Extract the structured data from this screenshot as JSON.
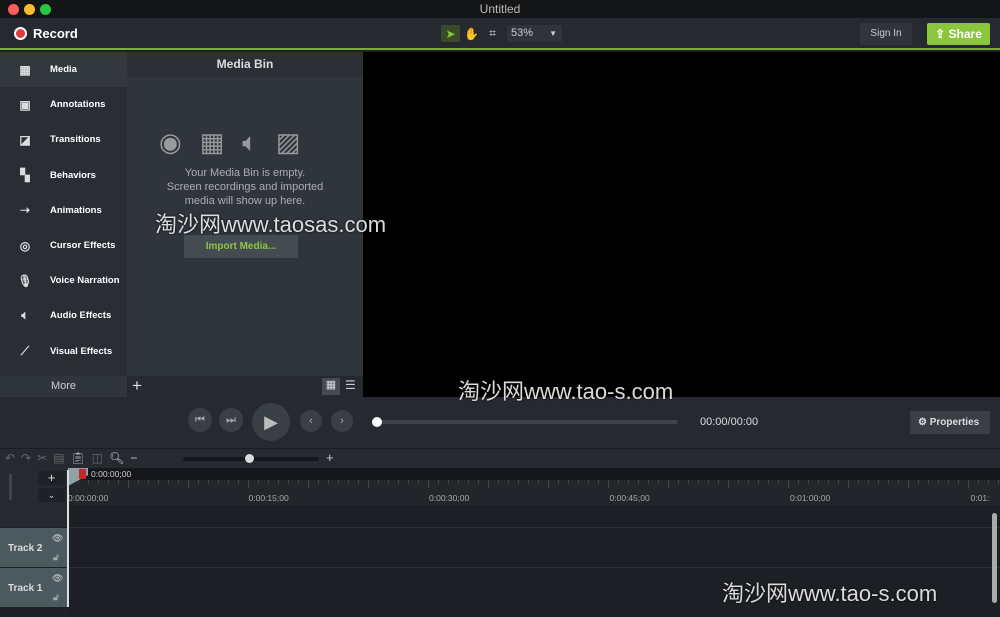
{
  "window": {
    "title": "Untitled"
  },
  "toolbar": {
    "record": "Record",
    "zoom": "53%",
    "sign_in": "Sign In",
    "share": "Share",
    "accent": "#8cc63f"
  },
  "sidebar": {
    "items": [
      {
        "label": "Media",
        "icon": "film-icon"
      },
      {
        "label": "Annotations",
        "icon": "annotation-icon"
      },
      {
        "label": "Transitions",
        "icon": "transition-icon"
      },
      {
        "label": "Behaviors",
        "icon": "behaviors-icon"
      },
      {
        "label": "Animations",
        "icon": "animation-icon"
      },
      {
        "label": "Cursor Effects",
        "icon": "cursor-icon"
      },
      {
        "label": "Voice Narration",
        "icon": "microphone-icon"
      },
      {
        "label": "Audio Effects",
        "icon": "speaker-icon"
      },
      {
        "label": "Visual Effects",
        "icon": "wand-icon"
      }
    ],
    "more": "More"
  },
  "media_bin": {
    "title": "Media Bin",
    "empty_line1": "Your Media Bin is empty.",
    "empty_line2": "Screen recordings and imported",
    "empty_line3": "media will show up here.",
    "import": "Import Media..."
  },
  "playback": {
    "time": "00:00/00:00",
    "properties": "Properties",
    "progress": 0
  },
  "timeline": {
    "playhead": "0:00:00;00",
    "ticks": [
      "0:00:00;00",
      "0:00:15;00",
      "0:00:30;00",
      "0:00:45;00",
      "0:01:00;00",
      "0:01:"
    ],
    "tracks": [
      "Track 2",
      "Track 1"
    ]
  },
  "watermarks": [
    "淘沙网www.taosas.com",
    "淘沙网www.tao-s.com",
    "淘沙网www.tao-s.com"
  ]
}
